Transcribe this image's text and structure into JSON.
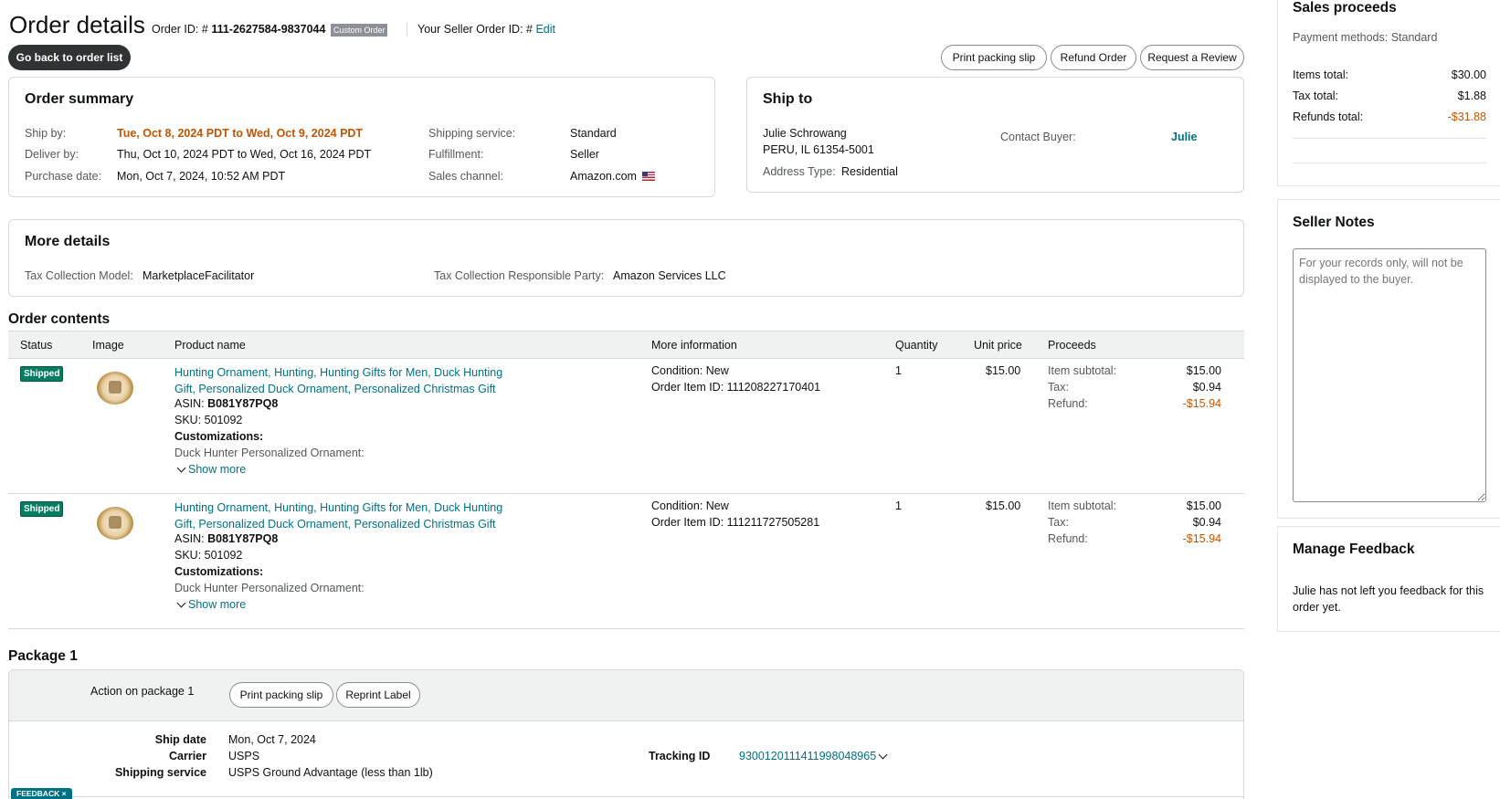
{
  "header": {
    "title": "Order details",
    "order_id_label": "Order ID: #",
    "order_id": "111-2627584-9837044",
    "custom_badge": "Custom Order",
    "seller_order_label": "Your Seller Order ID: #",
    "seller_order_edit": "Edit",
    "back_button": "Go back to order list",
    "actions": [
      "Print packing slip",
      "Refund Order",
      "Request a Review"
    ]
  },
  "order_summary": {
    "title": "Order summary",
    "ship_by_label": "Ship by:",
    "ship_by": "Tue, Oct 8, 2024 PDT to Wed, Oct 9, 2024 PDT",
    "deliver_by_label": "Deliver by:",
    "deliver_by": "Thu, Oct 10, 2024 PDT to Wed, Oct 16, 2024 PDT",
    "purchase_date_label": "Purchase date:",
    "purchase_date": "Mon, Oct 7, 2024, 10:52 AM PDT",
    "shipping_service_label": "Shipping service:",
    "shipping_service": "Standard",
    "fulfillment_label": "Fulfillment:",
    "fulfillment": "Seller",
    "sales_channel_label": "Sales channel:",
    "sales_channel": "Amazon.com"
  },
  "ship_to": {
    "title": "Ship to",
    "name": "Julie Schrowang",
    "address": "PERU, IL 61354-5001",
    "address_type_label": "Address Type:",
    "address_type": "Residential",
    "contact_label": "Contact Buyer:",
    "contact_name": "Julie"
  },
  "more_details": {
    "title": "More details",
    "tax_model_label": "Tax Collection Model:",
    "tax_model": "MarketplaceFacilitator",
    "tax_party_label": "Tax Collection Responsible Party:",
    "tax_party": "Amazon Services LLC"
  },
  "order_contents": {
    "title": "Order contents",
    "columns": [
      "Status",
      "Image",
      "Product name",
      "More information",
      "Quantity",
      "Unit price",
      "Proceeds"
    ],
    "items": [
      {
        "status": "Shipped",
        "name_line1": "Hunting Ornament, Hunting, Hunting Gifts for Men, Duck Hunting",
        "name_line2": "Gift, Personalized Duck Ornament, Personalized Christmas Gift",
        "asin_label": "ASIN:",
        "asin": "B081Y87PQ8",
        "sku": "SKU: 501092",
        "customizations": "Customizations:",
        "custom_line": "Duck Hunter Personalized Ornament:",
        "show_more": "Show more",
        "condition": "Condition: New",
        "order_item_id": "Order Item ID: 111208227170401",
        "quantity": "1",
        "unit_price": "$15.00",
        "subtotal_label": "Item subtotal:",
        "subtotal": "$15.00",
        "tax_label": "Tax:",
        "tax": "$0.94",
        "refund_label": "Refund:",
        "refund": "-$15.94"
      },
      {
        "status": "Shipped",
        "name_line1": "Hunting Ornament, Hunting, Hunting Gifts for Men, Duck Hunting",
        "name_line2": "Gift, Personalized Duck Ornament, Personalized Christmas Gift",
        "asin_label": "ASIN:",
        "asin": "B081Y87PQ8",
        "sku": "SKU: 501092",
        "customizations": "Customizations:",
        "custom_line": "Duck Hunter Personalized Ornament:",
        "show_more": "Show more",
        "condition": "Condition: New",
        "order_item_id": "Order Item ID: 111211727505281",
        "quantity": "1",
        "unit_price": "$15.00",
        "subtotal_label": "Item subtotal:",
        "subtotal": "$15.00",
        "tax_label": "Tax:",
        "tax": "$0.94",
        "refund_label": "Refund:",
        "refund": "-$15.94"
      }
    ]
  },
  "package": {
    "title": "Package 1",
    "action_label": "Action on package 1",
    "print_slip": "Print packing slip",
    "reprint_label": "Reprint Label",
    "ship_date_label": "Ship date",
    "ship_date": "Mon, Oct 7, 2024",
    "carrier_label": "Carrier",
    "carrier": "USPS",
    "service_label": "Shipping service",
    "service": "USPS Ground Advantage (less than 1lb)",
    "tracking_label": "Tracking ID",
    "tracking_id": "9300120111411998048965",
    "feedback_tab": "FEEDBACK"
  },
  "sales_proceeds": {
    "title": "Sales proceeds",
    "payment_methods": "Payment methods: Standard",
    "items_total_label": "Items total:",
    "items_total": "$30.00",
    "tax_total_label": "Tax total:",
    "tax_total": "$1.88",
    "refunds_total_label": "Refunds total:",
    "refunds_total": "-$31.88"
  },
  "seller_notes": {
    "title": "Seller Notes",
    "placeholder": "For your records only, will not be displayed to the buyer."
  },
  "feedback": {
    "title": "Manage Feedback",
    "text": "Julie has not left you feedback for this order yet."
  },
  "colors": {
    "link": "#007185",
    "warning": "#c45500",
    "shipped": "#067d62"
  }
}
